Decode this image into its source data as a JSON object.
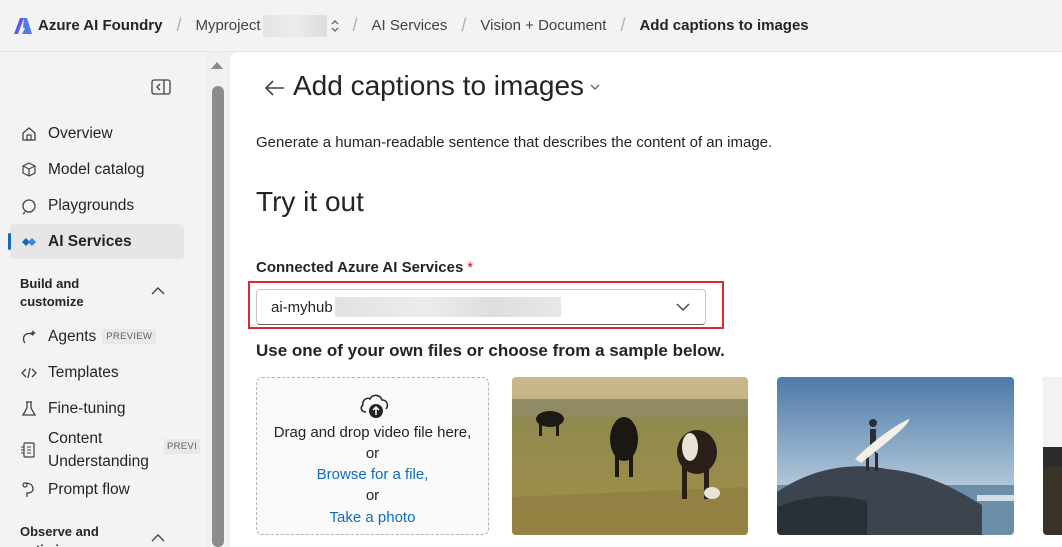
{
  "header": {
    "brand": "Azure AI Foundry",
    "breadcrumbs": [
      "Myproject",
      "AI Services",
      "Vision + Document",
      "Add captions to images"
    ]
  },
  "sidebar": {
    "items": [
      {
        "label": "Overview",
        "icon": "home-icon"
      },
      {
        "label": "Model catalog",
        "icon": "cube-icon"
      },
      {
        "label": "Playgrounds",
        "icon": "playground-icon"
      },
      {
        "label": "AI Services",
        "icon": "ai-services-icon",
        "active": true
      }
    ],
    "sections": [
      {
        "title": "Build and customize",
        "items": [
          {
            "label": "Agents",
            "badge": "PREVIEW",
            "icon": "agents-icon"
          },
          {
            "label": "Templates",
            "icon": "code-icon"
          },
          {
            "label": "Fine-tuning",
            "icon": "beaker-icon"
          },
          {
            "label": "Content Understanding",
            "badge": "PREVI",
            "icon": "content-understanding-icon"
          },
          {
            "label": "Prompt flow",
            "icon": "flow-icon"
          }
        ]
      },
      {
        "title": "Observe and optimize",
        "items": []
      }
    ],
    "section_title_lines": [
      [
        "Build and",
        "customize"
      ],
      [
        "Observe and",
        "optimize"
      ]
    ]
  },
  "main": {
    "title": "Add captions to images",
    "description": "Generate a human-readable sentence that describes the content of an image.",
    "try_title": "Try it out",
    "connected_label": "Connected Azure AI Services",
    "required_marker": "*",
    "connected_value_prefix": "ai-myhub",
    "files_label": "Use one of your own files or choose from a sample below.",
    "dropzone": {
      "line1": "Drag and drop video file here,",
      "or1": "or",
      "browse": "Browse for a file,",
      "or2": "or",
      "photo": "Take a photo"
    },
    "samples": [
      "cows grazing in a field",
      "surfer on a rock by the sea",
      "partially visible sample image"
    ]
  },
  "colors": {
    "accent": "#0f6cbd",
    "highlight_border": "#e0282e",
    "required": "#c50f1f",
    "sidebar_bg": "#f3f3f3"
  }
}
